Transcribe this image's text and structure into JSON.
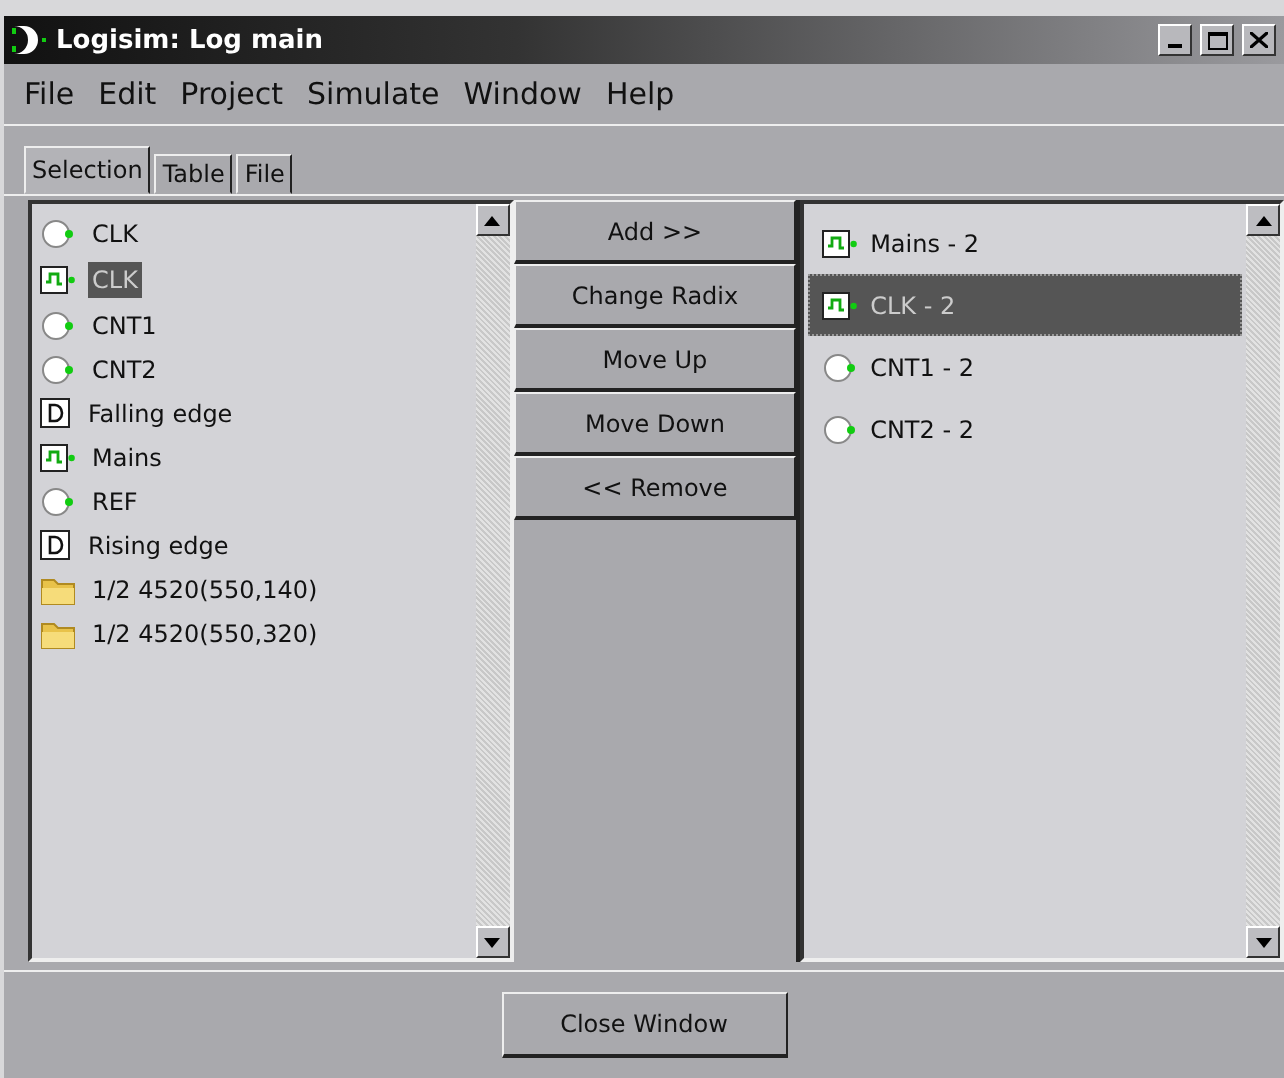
{
  "window": {
    "title": "Logisim: Log main"
  },
  "menu": [
    "File",
    "Edit",
    "Project",
    "Simulate",
    "Window",
    "Help"
  ],
  "tabs": [
    {
      "label": "Selection",
      "selected": true
    },
    {
      "label": "Table",
      "selected": false
    },
    {
      "label": "File",
      "selected": false
    }
  ],
  "available": [
    {
      "kind": "input",
      "label": "CLK",
      "selected": false
    },
    {
      "kind": "clock",
      "label": "CLK",
      "selected": true
    },
    {
      "kind": "input",
      "label": "CNT1",
      "selected": false
    },
    {
      "kind": "input",
      "label": "CNT2",
      "selected": false
    },
    {
      "kind": "probe",
      "label": "Falling edge",
      "selected": false
    },
    {
      "kind": "clock",
      "label": "Mains",
      "selected": false
    },
    {
      "kind": "input",
      "label": "REF",
      "selected": false
    },
    {
      "kind": "probe",
      "label": "Rising edge",
      "selected": false
    },
    {
      "kind": "folder",
      "label": "1/2 4520(550,140)",
      "selected": false
    },
    {
      "kind": "folder",
      "label": "1/2 4520(550,320)",
      "selected": false
    }
  ],
  "actions": [
    "Add >>",
    "Change Radix",
    "Move Up",
    "Move Down",
    "<< Remove"
  ],
  "logged": [
    {
      "kind": "clock",
      "label": "Mains - 2",
      "selected": false
    },
    {
      "kind": "clock",
      "label": "CLK - 2",
      "selected": true
    },
    {
      "kind": "input",
      "label": "CNT1 - 2",
      "selected": false
    },
    {
      "kind": "input",
      "label": "CNT2 - 2",
      "selected": false
    }
  ],
  "close_button": "Close Window"
}
